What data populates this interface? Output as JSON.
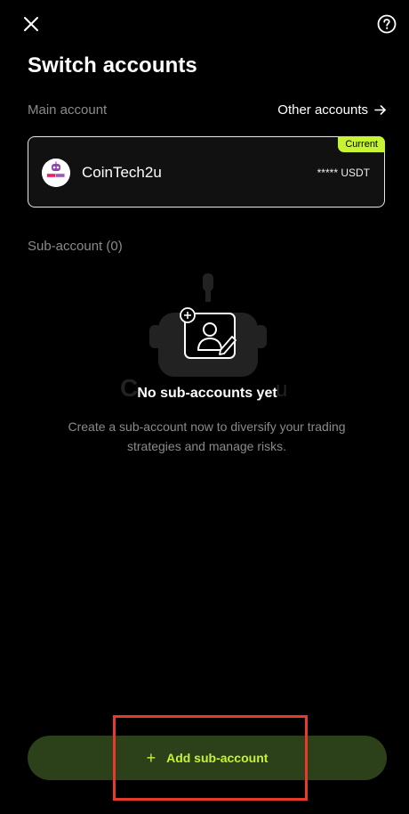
{
  "header": {
    "close_icon": "close-icon",
    "help_icon": "help-circle-icon"
  },
  "title": "Switch accounts",
  "main_account": {
    "section_label": "Main account",
    "other_accounts_link": "Other accounts",
    "card": {
      "badge": "Current",
      "name": "CoinTech2u",
      "balance": "***** USDT",
      "avatar_icon": "coin-tech-logo-icon",
      "badge_color": "#c6f432"
    }
  },
  "sub_accounts": {
    "section_label": "Sub-account (0)",
    "empty_title": "No sub-accounts yet",
    "empty_description": "Create a sub-account now to diversify your trading strategies and manage risks."
  },
  "add_button": {
    "label": "Add sub-account",
    "plus": "+",
    "bg_color": "#2c4019",
    "text_color": "#c6f432"
  },
  "highlight_color": "#e8392b"
}
